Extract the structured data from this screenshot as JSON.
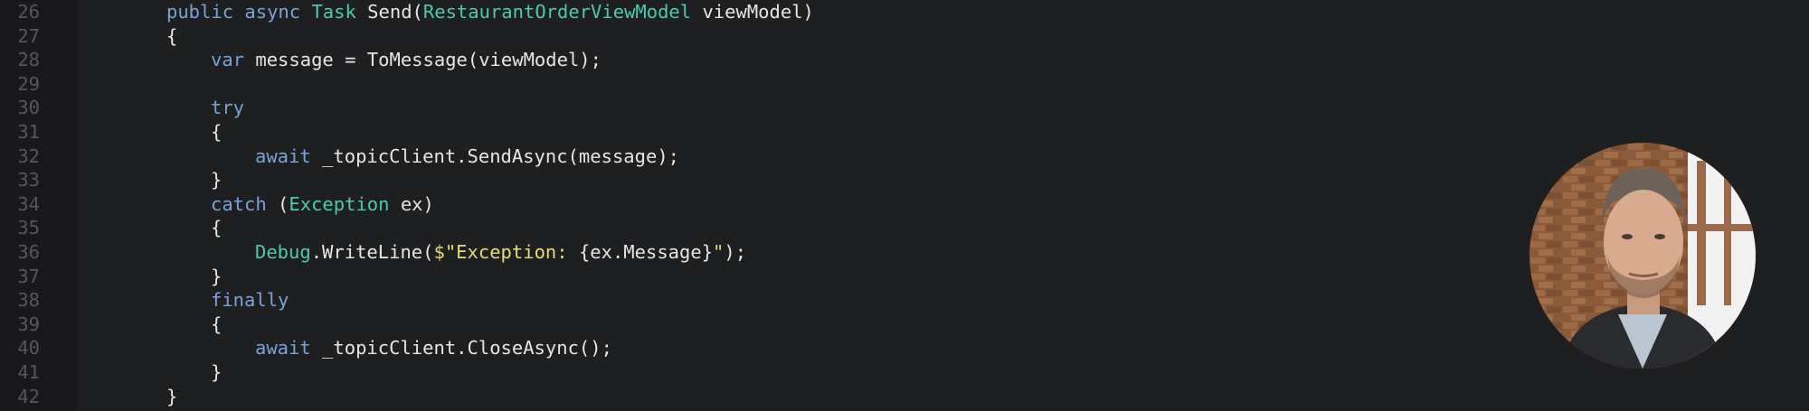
{
  "editor": {
    "lines": [
      {
        "number": "26",
        "indent": 2,
        "tokens": [
          {
            "t": "public",
            "c": "kw"
          },
          {
            "t": " ",
            "c": "tx"
          },
          {
            "t": "async",
            "c": "kw"
          },
          {
            "t": " ",
            "c": "tx"
          },
          {
            "t": "Task",
            "c": "ty"
          },
          {
            "t": " Send(",
            "c": "tx"
          },
          {
            "t": "RestaurantOrderViewModel",
            "c": "ty"
          },
          {
            "t": " viewModel)",
            "c": "tx"
          }
        ]
      },
      {
        "number": "27",
        "indent": 2,
        "tokens": [
          {
            "t": "{",
            "c": "tx"
          }
        ]
      },
      {
        "number": "28",
        "indent": 3,
        "tokens": [
          {
            "t": "var",
            "c": "kw"
          },
          {
            "t": " message = ToMessage(viewModel);",
            "c": "tx"
          }
        ]
      },
      {
        "number": "29",
        "indent": 0,
        "tokens": []
      },
      {
        "number": "30",
        "indent": 3,
        "tokens": [
          {
            "t": "try",
            "c": "kw"
          }
        ]
      },
      {
        "number": "31",
        "indent": 3,
        "tokens": [
          {
            "t": "{",
            "c": "tx"
          }
        ]
      },
      {
        "number": "32",
        "indent": 4,
        "tokens": [
          {
            "t": "await",
            "c": "kw"
          },
          {
            "t": " _topicClient.SendAsync(message);",
            "c": "tx"
          }
        ]
      },
      {
        "number": "33",
        "indent": 3,
        "tokens": [
          {
            "t": "}",
            "c": "tx"
          }
        ]
      },
      {
        "number": "34",
        "indent": 3,
        "tokens": [
          {
            "t": "catch",
            "c": "kw"
          },
          {
            "t": " (",
            "c": "tx"
          },
          {
            "t": "Exception",
            "c": "ty"
          },
          {
            "t": " ex)",
            "c": "tx"
          }
        ]
      },
      {
        "number": "35",
        "indent": 3,
        "tokens": [
          {
            "t": "{",
            "c": "tx"
          }
        ]
      },
      {
        "number": "36",
        "indent": 4,
        "tokens": [
          {
            "t": "Debug",
            "c": "ty"
          },
          {
            "t": ".WriteLine(",
            "c": "tx"
          },
          {
            "t": "$\"Exception: ",
            "c": "st"
          },
          {
            "t": "{ex.Message}",
            "c": "tx"
          },
          {
            "t": "\"",
            "c": "st"
          },
          {
            "t": ");",
            "c": "tx"
          }
        ]
      },
      {
        "number": "37",
        "indent": 3,
        "tokens": [
          {
            "t": "}",
            "c": "tx"
          }
        ]
      },
      {
        "number": "38",
        "indent": 3,
        "tokens": [
          {
            "t": "finally",
            "c": "kw"
          }
        ]
      },
      {
        "number": "39",
        "indent": 3,
        "tokens": [
          {
            "t": "{",
            "c": "tx"
          }
        ]
      },
      {
        "number": "40",
        "indent": 4,
        "tokens": [
          {
            "t": "await",
            "c": "kw"
          },
          {
            "t": " _topicClient.CloseAsync();",
            "c": "tx"
          }
        ]
      },
      {
        "number": "41",
        "indent": 3,
        "tokens": [
          {
            "t": "}",
            "c": "tx"
          }
        ]
      },
      {
        "number": "42",
        "indent": 2,
        "tokens": [
          {
            "t": "}",
            "c": "tx"
          }
        ]
      }
    ]
  },
  "colors": {
    "background": "#1e1f21",
    "gutter": "#19191b",
    "line_number": "#55575b",
    "keyword": "#7aa2d6",
    "type": "#4ec9b0",
    "string": "#e6db74",
    "text": "#e6e6e6"
  },
  "avatar": {
    "icon": "presenter-webcam-avatar"
  }
}
